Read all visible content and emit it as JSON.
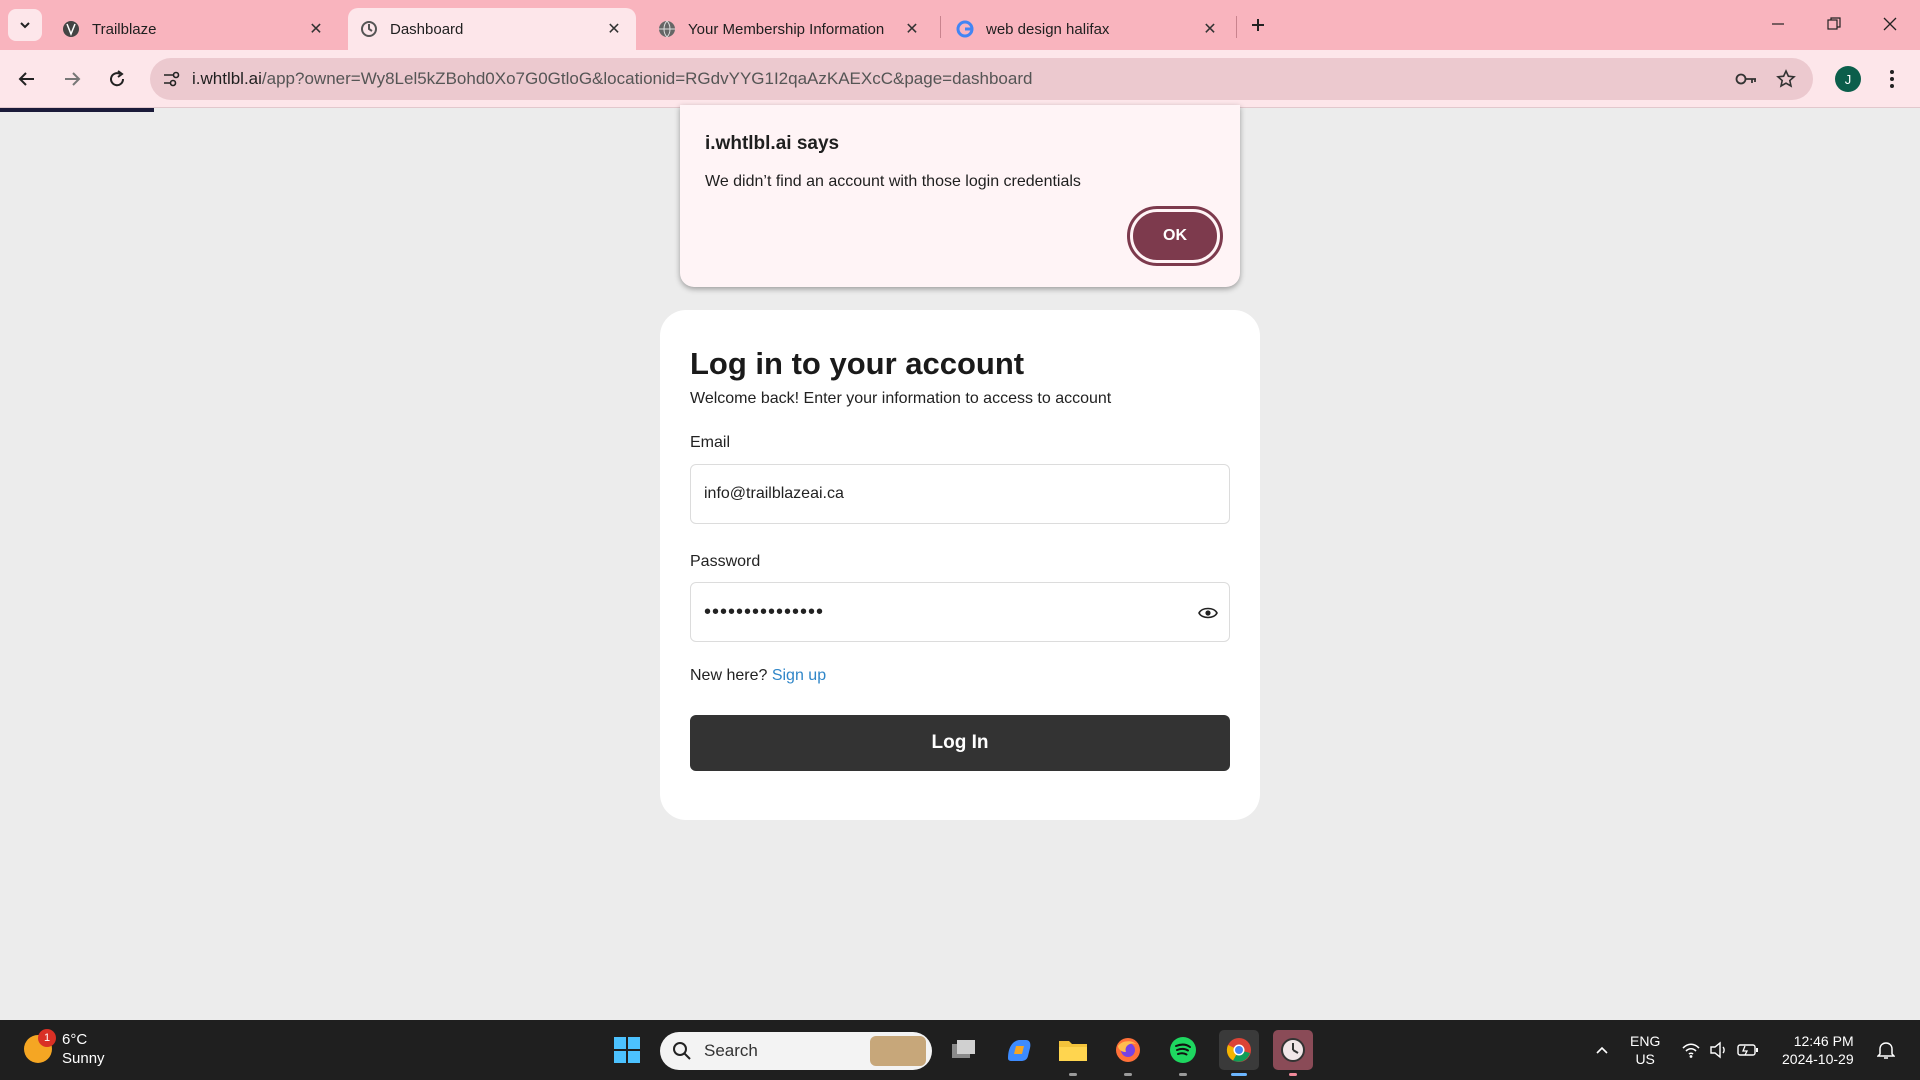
{
  "browser": {
    "tabs": [
      {
        "title": "Trailblaze",
        "icon": "trailblaze-favicon"
      },
      {
        "title": "Dashboard",
        "icon": "dashboard-favicon",
        "active": true
      },
      {
        "title": "Your Membership Information",
        "icon": "globe-icon"
      },
      {
        "title": "web design halifax",
        "icon": "google-icon"
      }
    ],
    "url_host": "i.whtlbl.ai",
    "url_rest": "/app?owner=Wy8Lel5kZBohd0Xo7G0GtloG&locationid=RGdvYYG1I2qaAzKAEXcC&page=dashboard",
    "profile_initial": "J"
  },
  "dialog": {
    "title": "i.whtlbl.ai says",
    "message": "We didn’t find an account with those login credentials",
    "ok_label": "OK"
  },
  "login": {
    "title": "Log in to your account",
    "subtitle": "Welcome back! Enter your information to access to account",
    "email_label": "Email",
    "email_value": "info@trailblazeai.ca",
    "password_label": "Password",
    "password_masked": "•••••••••••••••",
    "new_here": "New here?",
    "signup_link": "Sign up",
    "submit_label": "Log In"
  },
  "taskbar": {
    "weather_temp": "6°C",
    "weather_desc": "Sunny",
    "weather_badge": "1",
    "search_placeholder": "Search",
    "lang_top": "ENG",
    "lang_bottom": "US",
    "time": "12:46 PM",
    "date": "2024-10-29"
  },
  "colors": {
    "tab_strip": "#f9b4be",
    "toolbar": "#fde6ea",
    "accent_button": "#333333",
    "dialog_ok": "#7d3a4d",
    "link": "#2f86c8"
  }
}
